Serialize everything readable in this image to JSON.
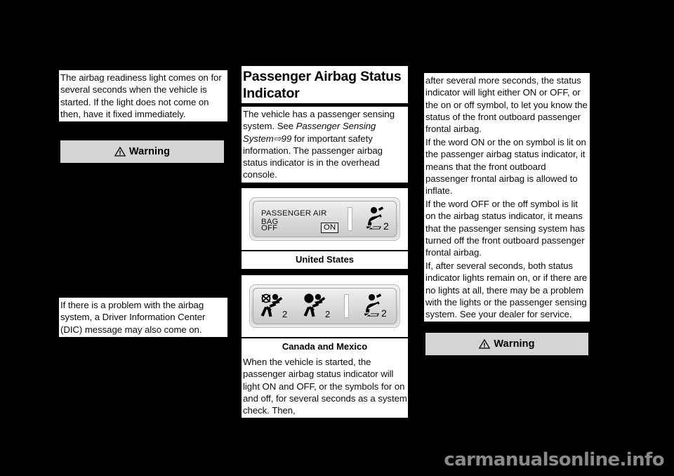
{
  "page": {
    "background_color": "#000000",
    "footer_watermark": "carmanualsonline.info"
  },
  "column_left": {
    "paragraph_1": "The airbag readiness light comes on for several seconds when the vehicle is started. If the light does not come on then, have it fixed immediately.",
    "warning_label": "Warning",
    "paragraph_2": "If there is a problem with the airbag system, a Driver Information Center (DIC) message may also come on."
  },
  "column_center": {
    "heading": "Passenger Airbag Status Indicator",
    "paragraph_1_part1": "The vehicle has a passenger sensing system. See ",
    "paragraph_1_italic": "Passenger Sensing System",
    "paragraph_1_arrow": "⇨",
    "paragraph_1_page": "99",
    "paragraph_1_part2": " for important safety information. The passenger airbag status indicator is in the overhead console.",
    "us_indicator": {
      "line_1": "PASSENGER AIR BAG",
      "line_2_off": "OFF",
      "line_2_on": "ON",
      "symbol_number": "2",
      "symbol_name": "belted-occupant-icon"
    },
    "us_caption": "United States",
    "ca_indicator": {
      "symbols": [
        {
          "name": "airbag-off-icon",
          "number": "2"
        },
        {
          "name": "airbag-on-icon",
          "number": "2"
        },
        {
          "name": "belted-occupant-icon",
          "number": "2"
        }
      ]
    },
    "ca_caption": "Canada and Mexico",
    "paragraph_2": "When the vehicle is started, the passenger airbag status indicator will light ON and OFF, or the symbols for on and off, for several seconds as a system check. Then,"
  },
  "column_right": {
    "paragraph_1": "after several more seconds, the status indicator will light either ON or OFF, or the on or off symbol, to let you know the status of the front outboard passenger frontal airbag.",
    "paragraph_2": "If the word ON or the on symbol is lit on the passenger airbag status indicator, it means that the front outboard passenger frontal airbag is allowed to inflate.",
    "paragraph_3": "If the word OFF or the off symbol is lit on the airbag status indicator, it means that the passenger sensing system has turned off the front outboard passenger frontal airbag.",
    "paragraph_4": "If, after several seconds, both status indicator lights remain on, or if there are no lights at all, there may be a problem with the lights or the passenger sensing system. See your dealer for service.",
    "warning_label": "Warning"
  },
  "colors": {
    "page_background": "#000000",
    "text_background": "#ffffff",
    "warning_background": "#d4d4d4",
    "text_color": "#000000",
    "watermark_color": "#8a8a8a"
  }
}
